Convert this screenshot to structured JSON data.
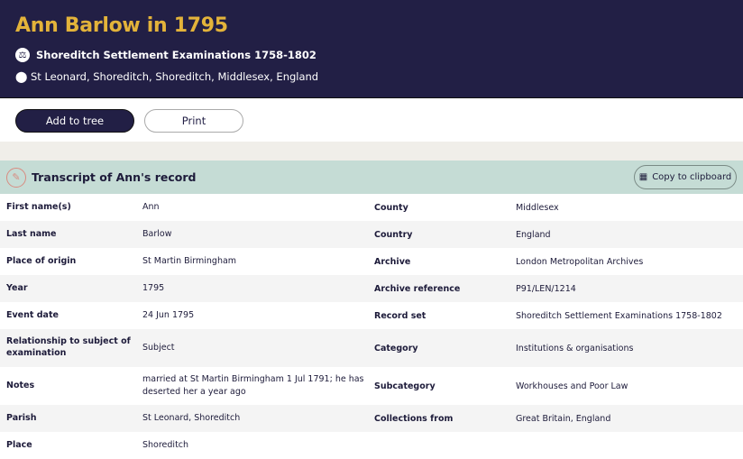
{
  "header": {
    "title": "Ann Barlow in 1795",
    "collection": "Shoreditch Settlement Examinations 1758-1802",
    "location": "St Leonard, Shoreditch, Shoreditch, Middlesex, England"
  },
  "actions": {
    "add_to_tree": "Add to tree",
    "print": "Print"
  },
  "transcript": {
    "title": "Transcript of Ann's record",
    "copy_label": "Copy to clipboard",
    "rows": [
      {
        "l1": "First name(s)",
        "v1": "Ann",
        "l2": "County",
        "v2": "Middlesex"
      },
      {
        "l1": "Last name",
        "v1": "Barlow",
        "l2": "Country",
        "v2": "England"
      },
      {
        "l1": "Place of origin",
        "v1": "St Martin Birmingham",
        "l2": "Archive",
        "v2": "London Metropolitan Archives"
      },
      {
        "l1": "Year",
        "v1": "1795",
        "l2": "Archive reference",
        "v2": "P91/LEN/1214"
      },
      {
        "l1": "Event date",
        "v1": "24 Jun 1795",
        "l2": "Record set",
        "v2": "Shoreditch Settlement Examinations 1758-1802"
      },
      {
        "l1": "Relationship to subject of examination",
        "v1": "Subject",
        "l2": "Category",
        "v2": "Institutions & organisations"
      },
      {
        "l1": "Notes",
        "v1": "married at St Martin Birmingham 1 Jul 1791; he has deserted her a year ago",
        "l2": "Subcategory",
        "v2": "Workhouses and Poor Law"
      },
      {
        "l1": "Parish",
        "v1": "St Leonard, Shoreditch",
        "l2": "Collections from",
        "v2": "Great Britain, England"
      },
      {
        "l1": "Place",
        "v1": "Shoreditch",
        "l2": "",
        "v2": ""
      }
    ]
  }
}
